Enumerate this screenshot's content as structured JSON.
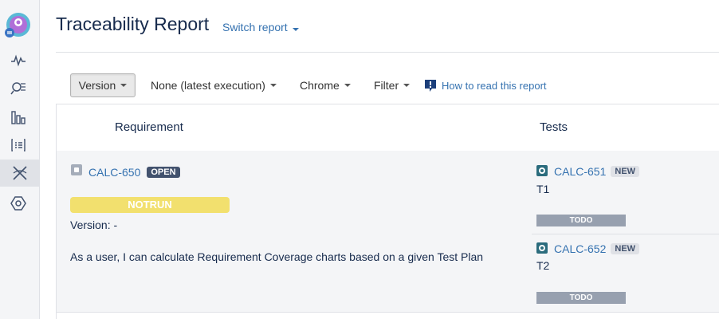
{
  "header": {
    "title": "Traceability Report",
    "switch_report": "Switch report"
  },
  "toolbar": {
    "version": "Version",
    "execution": "None (latest execution)",
    "environment": "Chrome",
    "filter": "Filter",
    "help": "How to read this report"
  },
  "table": {
    "col_requirement": "Requirement",
    "col_tests": "Tests"
  },
  "requirement": {
    "key": "CALC-650",
    "status": "OPEN",
    "coverage": "NOTRUN",
    "version": "Version: -",
    "summary": "As a user, I can calculate Requirement Coverage charts based on a given Test Plan"
  },
  "tests": [
    {
      "key": "CALC-651",
      "status": "NEW",
      "name": "T1",
      "result": "TODO"
    },
    {
      "key": "CALC-652",
      "status": "NEW",
      "name": "T2",
      "result": "TODO"
    }
  ],
  "sidebar": {
    "icons": [
      "activity-icon",
      "search-list-icon",
      "bar-chart-icon",
      "list-icon",
      "xray-icon",
      "hexagon-icon"
    ],
    "active_index": 4
  },
  "colors": {
    "link": "#3572b0",
    "notrun": "#f2e06e",
    "todo": "#97a0af",
    "open_lozenge": "#42526e"
  }
}
